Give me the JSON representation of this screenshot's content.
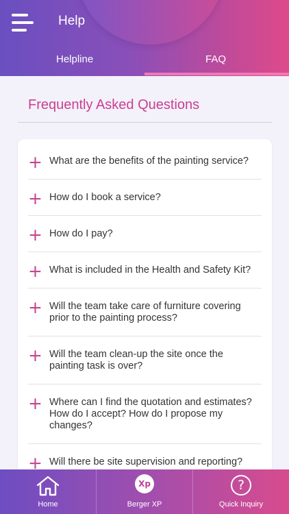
{
  "header": {
    "title": "Help",
    "tabs": [
      {
        "label": "Helpline",
        "active": false
      },
      {
        "label": "FAQ",
        "active": true
      }
    ],
    "accent_color": "#ef79b6"
  },
  "main": {
    "section_title": "Frequently Asked Questions",
    "faq": [
      "What are the benefits of the painting service?",
      "How do I book a service?",
      "How do I pay?",
      "What is included in the Health and Safety Kit?",
      "Will the team take care of furniture covering prior to the painting process?",
      "Will the team clean-up the site once the painting task is over?",
      "Where can I find the quotation and estimates? How do I accept? How do I propose my changes?",
      "Will there be site supervision and reporting?"
    ],
    "expand_icon": "plus-icon"
  },
  "bottom_nav": {
    "items": [
      {
        "label": "Home",
        "icon": "home-icon"
      },
      {
        "label": "Berger XP",
        "icon": "berger-xp-icon",
        "icon_text": "Xp"
      },
      {
        "label": "Quick Inquiry",
        "icon": "question-icon",
        "icon_text": "?"
      }
    ]
  },
  "colors": {
    "heading": "#cc3d91",
    "plus": "#c7448f",
    "header_gradient_start": "#6a4fc0",
    "header_gradient_end": "#de4a8a"
  }
}
